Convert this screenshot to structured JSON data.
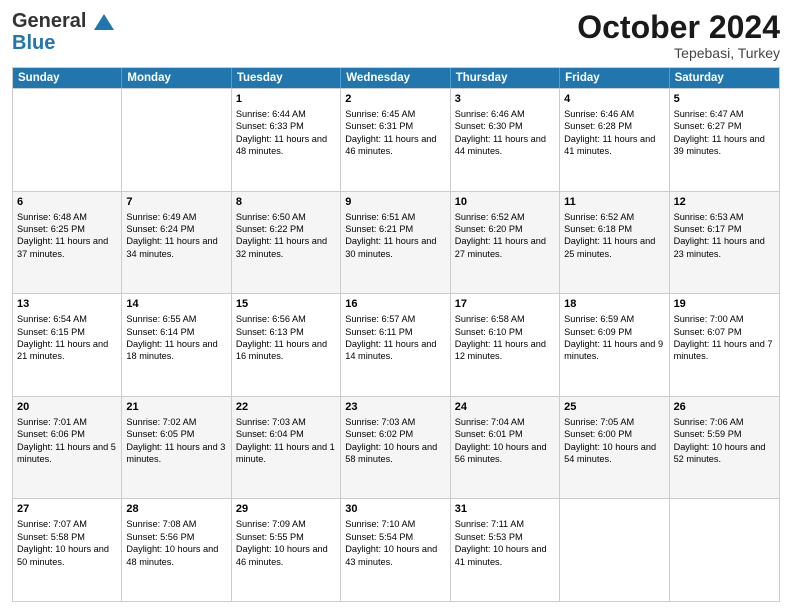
{
  "logo": {
    "general": "General",
    "blue": "Blue"
  },
  "header": {
    "month": "October 2024",
    "location": "Tepebasi, Turkey"
  },
  "weekdays": [
    "Sunday",
    "Monday",
    "Tuesday",
    "Wednesday",
    "Thursday",
    "Friday",
    "Saturday"
  ],
  "weeks": [
    {
      "cells": [
        {
          "day": "",
          "content": ""
        },
        {
          "day": "",
          "content": ""
        },
        {
          "day": "1",
          "content": "Sunrise: 6:44 AM\nSunset: 6:33 PM\nDaylight: 11 hours and 48 minutes."
        },
        {
          "day": "2",
          "content": "Sunrise: 6:45 AM\nSunset: 6:31 PM\nDaylight: 11 hours and 46 minutes."
        },
        {
          "day": "3",
          "content": "Sunrise: 6:46 AM\nSunset: 6:30 PM\nDaylight: 11 hours and 44 minutes."
        },
        {
          "day": "4",
          "content": "Sunrise: 6:46 AM\nSunset: 6:28 PM\nDaylight: 11 hours and 41 minutes."
        },
        {
          "day": "5",
          "content": "Sunrise: 6:47 AM\nSunset: 6:27 PM\nDaylight: 11 hours and 39 minutes."
        }
      ]
    },
    {
      "cells": [
        {
          "day": "6",
          "content": "Sunrise: 6:48 AM\nSunset: 6:25 PM\nDaylight: 11 hours and 37 minutes."
        },
        {
          "day": "7",
          "content": "Sunrise: 6:49 AM\nSunset: 6:24 PM\nDaylight: 11 hours and 34 minutes."
        },
        {
          "day": "8",
          "content": "Sunrise: 6:50 AM\nSunset: 6:22 PM\nDaylight: 11 hours and 32 minutes."
        },
        {
          "day": "9",
          "content": "Sunrise: 6:51 AM\nSunset: 6:21 PM\nDaylight: 11 hours and 30 minutes."
        },
        {
          "day": "10",
          "content": "Sunrise: 6:52 AM\nSunset: 6:20 PM\nDaylight: 11 hours and 27 minutes."
        },
        {
          "day": "11",
          "content": "Sunrise: 6:52 AM\nSunset: 6:18 PM\nDaylight: 11 hours and 25 minutes."
        },
        {
          "day": "12",
          "content": "Sunrise: 6:53 AM\nSunset: 6:17 PM\nDaylight: 11 hours and 23 minutes."
        }
      ]
    },
    {
      "cells": [
        {
          "day": "13",
          "content": "Sunrise: 6:54 AM\nSunset: 6:15 PM\nDaylight: 11 hours and 21 minutes."
        },
        {
          "day": "14",
          "content": "Sunrise: 6:55 AM\nSunset: 6:14 PM\nDaylight: 11 hours and 18 minutes."
        },
        {
          "day": "15",
          "content": "Sunrise: 6:56 AM\nSunset: 6:13 PM\nDaylight: 11 hours and 16 minutes."
        },
        {
          "day": "16",
          "content": "Sunrise: 6:57 AM\nSunset: 6:11 PM\nDaylight: 11 hours and 14 minutes."
        },
        {
          "day": "17",
          "content": "Sunrise: 6:58 AM\nSunset: 6:10 PM\nDaylight: 11 hours and 12 minutes."
        },
        {
          "day": "18",
          "content": "Sunrise: 6:59 AM\nSunset: 6:09 PM\nDaylight: 11 hours and 9 minutes."
        },
        {
          "day": "19",
          "content": "Sunrise: 7:00 AM\nSunset: 6:07 PM\nDaylight: 11 hours and 7 minutes."
        }
      ]
    },
    {
      "cells": [
        {
          "day": "20",
          "content": "Sunrise: 7:01 AM\nSunset: 6:06 PM\nDaylight: 11 hours and 5 minutes."
        },
        {
          "day": "21",
          "content": "Sunrise: 7:02 AM\nSunset: 6:05 PM\nDaylight: 11 hours and 3 minutes."
        },
        {
          "day": "22",
          "content": "Sunrise: 7:03 AM\nSunset: 6:04 PM\nDaylight: 11 hours and 1 minute."
        },
        {
          "day": "23",
          "content": "Sunrise: 7:03 AM\nSunset: 6:02 PM\nDaylight: 10 hours and 58 minutes."
        },
        {
          "day": "24",
          "content": "Sunrise: 7:04 AM\nSunset: 6:01 PM\nDaylight: 10 hours and 56 minutes."
        },
        {
          "day": "25",
          "content": "Sunrise: 7:05 AM\nSunset: 6:00 PM\nDaylight: 10 hours and 54 minutes."
        },
        {
          "day": "26",
          "content": "Sunrise: 7:06 AM\nSunset: 5:59 PM\nDaylight: 10 hours and 52 minutes."
        }
      ]
    },
    {
      "cells": [
        {
          "day": "27",
          "content": "Sunrise: 7:07 AM\nSunset: 5:58 PM\nDaylight: 10 hours and 50 minutes."
        },
        {
          "day": "28",
          "content": "Sunrise: 7:08 AM\nSunset: 5:56 PM\nDaylight: 10 hours and 48 minutes."
        },
        {
          "day": "29",
          "content": "Sunrise: 7:09 AM\nSunset: 5:55 PM\nDaylight: 10 hours and 46 minutes."
        },
        {
          "day": "30",
          "content": "Sunrise: 7:10 AM\nSunset: 5:54 PM\nDaylight: 10 hours and 43 minutes."
        },
        {
          "day": "31",
          "content": "Sunrise: 7:11 AM\nSunset: 5:53 PM\nDaylight: 10 hours and 41 minutes."
        },
        {
          "day": "",
          "content": ""
        },
        {
          "day": "",
          "content": ""
        }
      ]
    }
  ]
}
